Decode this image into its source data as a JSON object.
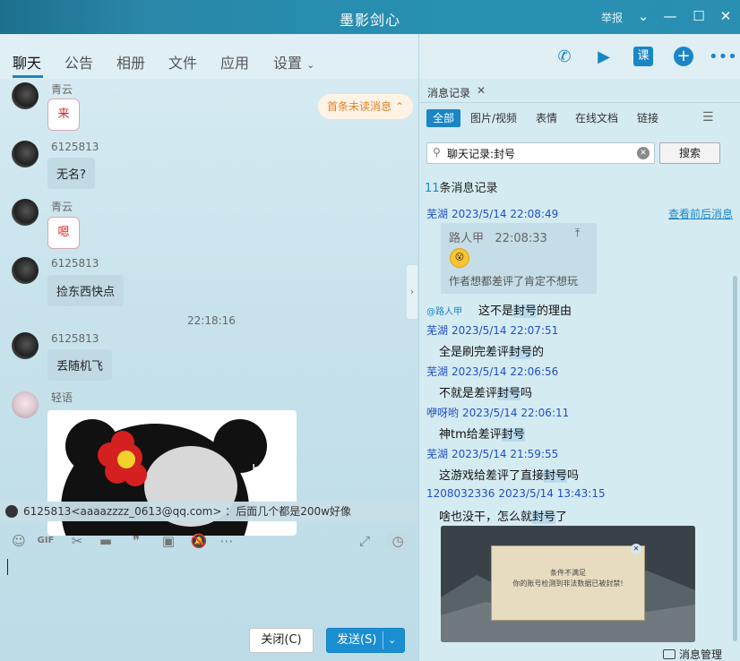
{
  "window": {
    "title": "墨影剑心",
    "report_label": "举报",
    "controls": [
      "chevron-down-icon",
      "minimize-icon",
      "maximize-icon",
      "close-icon"
    ]
  },
  "tabs": [
    {
      "label": "聊天",
      "active": true
    },
    {
      "label": "公告"
    },
    {
      "label": "相册"
    },
    {
      "label": "文件"
    },
    {
      "label": "应用"
    },
    {
      "label": "设置"
    }
  ],
  "header_actions": {
    "lesson_label": "课"
  },
  "chat": {
    "unread_label": "首条未读消息",
    "messages": [
      {
        "sender": "青云",
        "sticker": "来"
      },
      {
        "sender": "6125813",
        "text": "无名?"
      },
      {
        "sender": "青云",
        "sticker": "嗯"
      },
      {
        "sender": "6125813",
        "text": "捡东西快点"
      },
      {
        "timestamp": "22:18:16"
      },
      {
        "sender": "6125813",
        "text": "丢随机飞"
      },
      {
        "sender": "轻语",
        "image": "meme-panda"
      }
    ],
    "quote_bar": "6125813<aaaazzzz_0613@qq.com> ：后面几个都是200w好像"
  },
  "input": {
    "close_label": "关闭(C)",
    "send_label": "发送(S)"
  },
  "history": {
    "tab_label": "消息记录",
    "filters": [
      "全部",
      "图片/视频",
      "表情",
      "在线文档",
      "链接"
    ],
    "search_value": "聊天记录:封号",
    "search_button": "搜索",
    "count_num": "11",
    "count_text": "条消息记录",
    "context_link": "查看前后消息",
    "reply_card": {
      "sender": "路人甲",
      "time": "22:08:33",
      "quoted": "作者想都差评了肯定不想玩"
    },
    "at_user": "@路人甲",
    "records": [
      {
        "name": "芜湖",
        "time": "2023/5/14 22:08:49",
        "text_before": "这不是",
        "keyword": "封号",
        "text_after": "的理由"
      },
      {
        "name": "芜湖",
        "time": "2023/5/14 22:07:51",
        "text_before": "全是刷完差评",
        "keyword": "封号",
        "text_after": "的"
      },
      {
        "name": "芜湖",
        "time": "2023/5/14 22:06:56",
        "text_before": "不就是差评",
        "keyword": "封号",
        "text_after": "吗"
      },
      {
        "name": "咿呀哟",
        "time": "2023/5/14 22:06:11",
        "text_before": "神tm给差评",
        "keyword": "封号",
        "text_after": ""
      },
      {
        "name": "芜湖",
        "time": "2023/5/14 21:59:55",
        "text_before": "这游戏给差评了直接",
        "keyword": "封号",
        "text_after": "吗"
      },
      {
        "name": "1208032336",
        "time": "2023/5/14 13:43:15",
        "text_before": "啥也没干，怎么就",
        "keyword": "封号",
        "text_after": "了"
      }
    ],
    "screenshot_dialog": {
      "line1": "条件不满足",
      "line2": "你的账号检测到非法数据已被封禁!"
    },
    "manage_label": "消息管理"
  }
}
